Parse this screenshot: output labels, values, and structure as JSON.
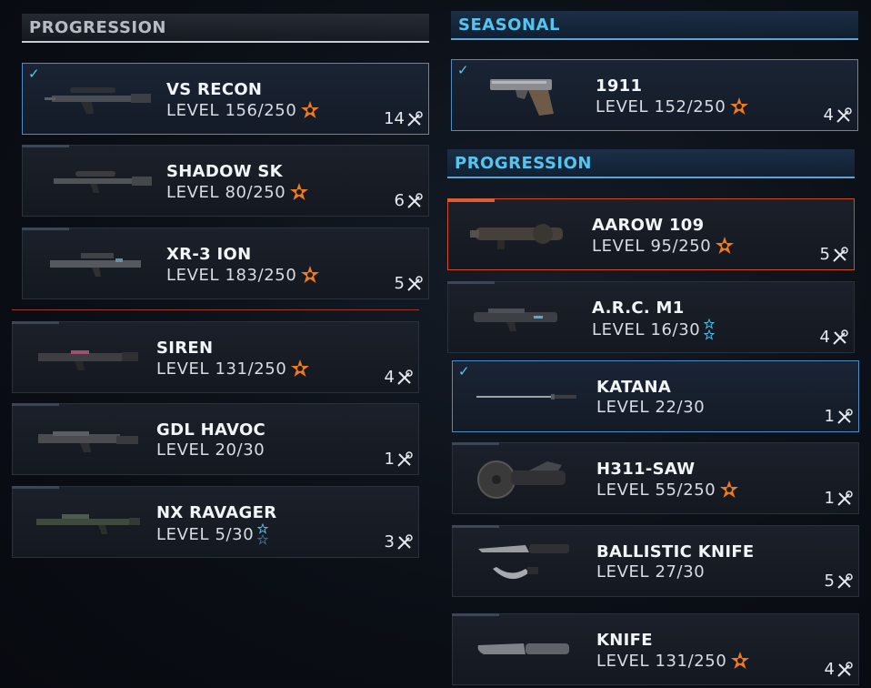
{
  "left": {
    "header": "PROGRESSION",
    "weapons": [
      {
        "name": "VS RECON",
        "level": "LEVEL 156/250",
        "star": "orange",
        "count": "14",
        "selected": true
      },
      {
        "name": "SHADOW SK",
        "level": "LEVEL 80/250",
        "star": "orange",
        "count": "6",
        "selected": false
      },
      {
        "name": "XR-3 ION",
        "level": "LEVEL 183/250",
        "star": "orange",
        "count": "5",
        "selected": false
      },
      {
        "name": "SIREN",
        "level": "LEVEL 131/250",
        "star": "orange",
        "count": "4",
        "selected": false
      },
      {
        "name": "GDL HAVOC",
        "level": "LEVEL 20/30",
        "star": "none",
        "count": "1",
        "selected": false
      },
      {
        "name": "NX RAVAGER",
        "level": "LEVEL 5/30",
        "star": "blue",
        "count": "3",
        "selected": false
      }
    ]
  },
  "right": {
    "seasonal_header": "SEASONAL",
    "seasonal": [
      {
        "name": "1911",
        "level": "LEVEL 152/250",
        "star": "orange",
        "count": "4",
        "selected": true
      }
    ],
    "progression_header": "PROGRESSION",
    "weapons": [
      {
        "name": "AAROW 109",
        "level": "LEVEL 95/250",
        "star": "orange",
        "count": "5",
        "highlight": true
      },
      {
        "name": "A.R.C. M1",
        "level": "LEVEL 16/30",
        "star": "blue",
        "count": "4"
      },
      {
        "name": "KATANA",
        "level": "LEVEL 22/30",
        "star": "none",
        "count": "1",
        "selected": true
      },
      {
        "name": "H311-SAW",
        "level": "LEVEL 55/250",
        "star": "orange",
        "count": "1"
      },
      {
        "name": "BALLISTIC KNIFE",
        "level": "LEVEL 27/30",
        "star": "none",
        "count": "5"
      },
      {
        "name": "KNIFE",
        "level": "LEVEL 131/250",
        "star": "orange",
        "count": "4"
      }
    ]
  },
  "colors": {
    "accent_blue": "#5ec6f0",
    "accent_orange": "#f07a1e",
    "highlight_red": "#cf4a2e"
  }
}
